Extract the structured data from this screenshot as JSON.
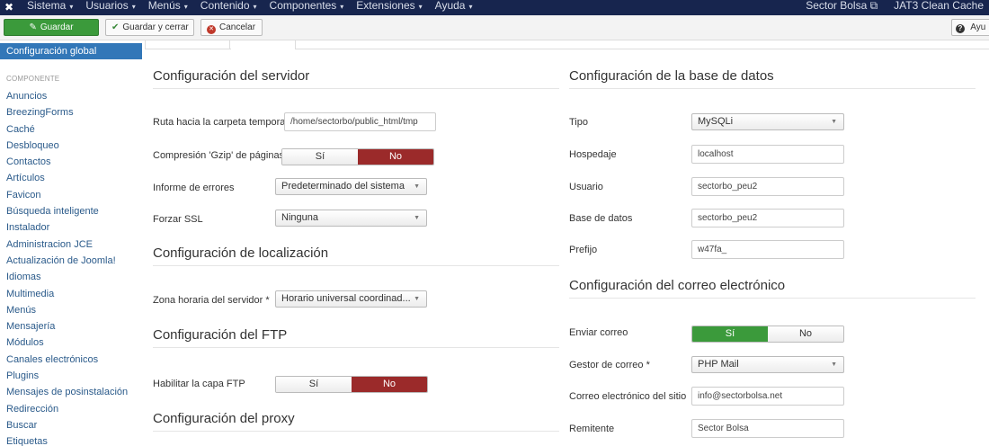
{
  "navbar": {
    "menu": [
      "Sistema",
      "Usuarios",
      "Menús",
      "Contenido",
      "Componentes",
      "Extensiones",
      "Ayuda"
    ],
    "right": [
      "Sector Bolsa",
      "JAT3 Clean Cache"
    ]
  },
  "toolbar": {
    "save": "Guardar",
    "save_close": "Guardar y cerrar",
    "cancel": "Cancelar",
    "help": "Ayu"
  },
  "sidebar": {
    "active": "Configuración global",
    "section": "COMPONENTE",
    "items": [
      "Anuncios",
      "BreezingForms",
      "Caché",
      "Desbloqueo",
      "Contactos",
      "Artículos",
      "Favicon",
      "Búsqueda inteligente",
      "Instalador",
      "Administracion JCE",
      "Actualización de Joomla!",
      "Idiomas",
      "Multimedia",
      "Menús",
      "Mensajería",
      "Módulos",
      "Canales electrónicos",
      "Plugins",
      "Mensajes de posinstalación",
      "Redirección",
      "Buscar",
      "Etiquetas"
    ]
  },
  "server": {
    "title": "Configuración del servidor",
    "tmp_label": "Ruta hacia la carpeta temporal",
    "tmp_value": "/home/sectorbo/public_html/tmp",
    "gzip_label": "Compresión 'Gzip' de páginas",
    "gzip_yes": "Sí",
    "gzip_no": "No",
    "errors_label": "Informe de errores",
    "errors_value": "Predeterminado del sistema",
    "ssl_label": "Forzar SSL",
    "ssl_value": "Ninguna"
  },
  "locale": {
    "title": "Configuración de localización",
    "tz_label": "Zona horaria del servidor *",
    "tz_value": "Horario universal coordinad..."
  },
  "ftp": {
    "title": "Configuración del FTP",
    "enable_label": "Habilitar la capa FTP",
    "yes": "Sí",
    "no": "No"
  },
  "proxy": {
    "title": "Configuración del proxy"
  },
  "database": {
    "title": "Configuración de la base de datos",
    "type_label": "Tipo",
    "type_value": "MySQLi",
    "host_label": "Hospedaje",
    "host_value": "localhost",
    "user_label": "Usuario",
    "user_value": "sectorbo_peu2",
    "db_label": "Base de datos",
    "db_value": "sectorbo_peu2",
    "prefix_label": "Prefijo",
    "prefix_value": "w47fa_"
  },
  "mail": {
    "title": "Configuración del correo electrónico",
    "send_label": "Enviar correo",
    "yes": "Sí",
    "no": "No",
    "mailer_label": "Gestor de correo *",
    "mailer_value": "PHP Mail",
    "from_email_label": "Correo electrónico del sitio",
    "from_email_value": "info@sectorbolsa.net",
    "from_name_label": "Remitente",
    "from_name_value": "Sector Bolsa"
  },
  "colors": {
    "navbar": "#17254e",
    "active_sidebar": "#3277b8",
    "toggle_no": "#9b2a2a",
    "toggle_yes": "#3b9a3b"
  }
}
